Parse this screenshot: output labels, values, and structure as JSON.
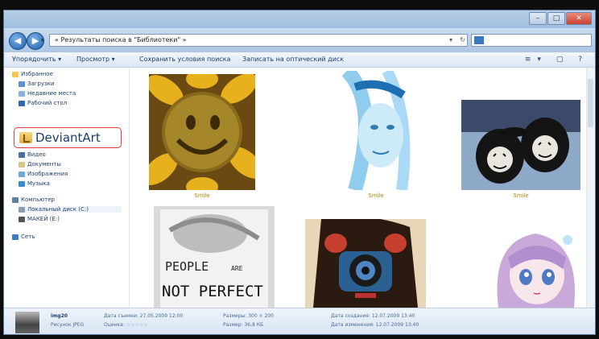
{
  "window": {
    "caption_buttons": [
      "–",
      "□",
      "✕"
    ]
  },
  "navbar": {
    "back_icon": "back-arrow-icon",
    "forward_icon": "forward-arrow-icon",
    "address": "« Результаты поиска в \"Библиотеки\" »",
    "search_placeholder": ""
  },
  "command_bar": {
    "items": [
      "Упорядочить ▾",
      "Просмотр ▾",
      "Сохранить условия поиска",
      "Записать на оптический диск"
    ],
    "view_controls": [
      "≡▾",
      "▢",
      "?"
    ]
  },
  "navigation": {
    "favorites": {
      "label": "Избранное",
      "items": [
        "Загрузки",
        "Недавние места",
        "Рабочий стол"
      ]
    },
    "highlighted_folder": "DeviantArt",
    "libraries": [
      "Видео",
      "Документы",
      "Изображения",
      "Музыка"
    ],
    "computer": {
      "label": "Компьютер",
      "items": [
        "Локальный диск (C:)",
        "МАКЕЙ (E:)"
      ]
    },
    "network": "Сеть"
  },
  "thumbnails": [
    {
      "name": "sunflower-smiley-thumbnail",
      "label": "Smile"
    },
    {
      "name": "blue-face-sketch-thumbnail",
      "label": "Smile"
    },
    {
      "name": "smiley-shoes-thumbnail",
      "label": "Smile"
    },
    {
      "name": "people-not-perfect-thumbnail",
      "label": "PEOPLE ARE NOT PERFECT"
    },
    {
      "name": "camera-girl-thumbnail",
      "label": ""
    },
    {
      "name": "anime-girl-thumbnail",
      "label": ""
    }
  ],
  "details": {
    "filename": "img20",
    "filetype": "Рисунок JPEG",
    "date_taken_label": "Дата съемки:",
    "date_taken": "27.05.2009 12:00",
    "rating_label": "Оценка:",
    "rating_stars": "☆☆☆☆☆",
    "dimensions_label": "Размеры:",
    "dimensions": "300 × 200",
    "size_label": "Размер:",
    "size": "36,8 КБ",
    "created_label": "Дата создания:",
    "created": "12.07.2009 13:40",
    "modified_label": "Дата изменения:",
    "modified": "12.07.2009 13:40"
  },
  "colors": {
    "accent": "#e03c3c",
    "label_gold": "#c08a10"
  }
}
